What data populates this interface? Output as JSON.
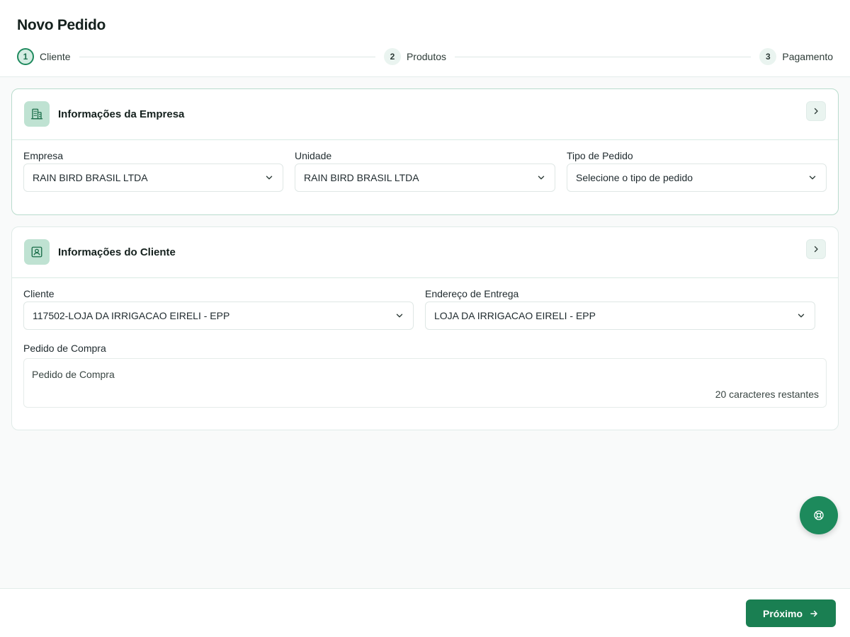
{
  "page": {
    "title": "Novo Pedido"
  },
  "stepper": {
    "steps": [
      {
        "number": "1",
        "label": "Cliente"
      },
      {
        "number": "2",
        "label": "Produtos"
      },
      {
        "number": "3",
        "label": "Pagamento"
      }
    ]
  },
  "company_section": {
    "title": "Informações da Empresa",
    "icon": "building-icon",
    "fields": {
      "empresa": {
        "label": "Empresa",
        "value": "RAIN BIRD BRASIL LTDA"
      },
      "unidade": {
        "label": "Unidade",
        "value": "RAIN BIRD BRASIL LTDA"
      },
      "tipo_pedido": {
        "label": "Tipo de Pedido",
        "placeholder": "Selecione o tipo de pedido"
      }
    }
  },
  "client_section": {
    "title": "Informações do Cliente",
    "icon": "contact-card-icon",
    "fields": {
      "cliente": {
        "label": "Cliente",
        "value": "117502-LOJA DA IRRIGACAO EIRELI - EPP"
      },
      "endereco": {
        "label": "Endereço de Entrega",
        "value": "LOJA DA IRRIGACAO EIRELI - EPP"
      },
      "pedido_compra": {
        "label": "Pedido de Compra",
        "placeholder": "Pedido de Compra",
        "counter": "20 caracteres restantes"
      }
    }
  },
  "footer": {
    "next_label": "Próximo"
  },
  "colors": {
    "accent": "#1a7f52",
    "accent_light": "#bfe2d2",
    "step_active_border": "#1f8a5e"
  }
}
